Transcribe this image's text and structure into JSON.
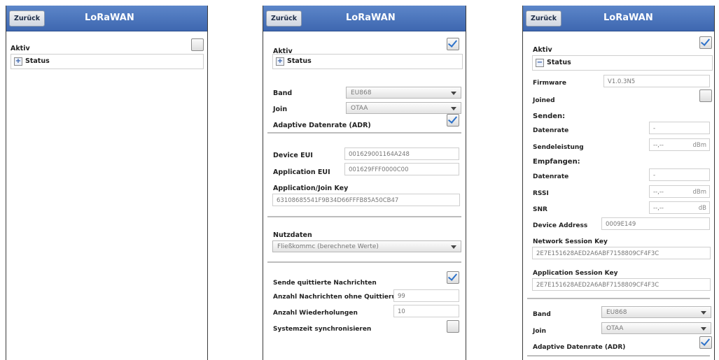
{
  "common": {
    "back_label": "Zurück",
    "title": "LoRaWAN",
    "aktiv": "Aktiv",
    "status": "Status",
    "plus": "+",
    "minus": "−"
  },
  "p2": {
    "band_label": "Band",
    "band_value": "EU868",
    "join_label": "Join",
    "join_value": "OTAA",
    "adr_label": "Adaptive Datenrate (ADR)",
    "device_eui_label": "Device EUI",
    "device_eui_value": "001629001164A248",
    "app_eui_label": "Application EUI",
    "app_eui_value": "001629FFF0000C00",
    "app_key_label": "Application/Join Key",
    "app_key_value": "63108685541F9B34D66FFFB85A50CB47",
    "nutzdaten_label": "Nutzdaten",
    "nutzdaten_value": "Fließkommc (berechnete Werte)",
    "sende_label": "Sende quittierte Nachrichten",
    "anzahl_ohne_label": "Anzahl Nachrichten ohne Quittierung",
    "anzahl_ohne_value": "99",
    "wiederholungen_label": "Anzahl Wiederholungen",
    "wiederholungen_value": "10",
    "systemzeit_label": "Systemzeit synchronisieren"
  },
  "p3": {
    "firmware_label": "Firmware",
    "firmware_value": "V1.0.3N5",
    "joined_label": "Joined",
    "senden_label": "Senden:",
    "datenrate_label": "Datenrate",
    "datenrate_send_value": "-",
    "sendeleistung_label": "Sendeleistung",
    "sendeleistung_value": "--,--",
    "sendeleistung_unit": "dBm",
    "empfangen_label": "Empfangen:",
    "datenrate_recv_value": "-",
    "rssi_label": "RSSI",
    "rssi_value": "--,--",
    "rssi_unit": "dBm",
    "snr_label": "SNR",
    "snr_value": "--,--",
    "snr_unit": "dB",
    "device_address_label": "Device Address",
    "device_address_value": "0009E149",
    "nwk_key_label": "Network Session Key",
    "nwk_key_value": "2E7E151628AED2A6ABF7158809CF4F3C",
    "app_session_label": "Application Session Key",
    "app_session_value": "2E7E151628AED2A6ABF7158809CF4F3C",
    "band_label": "Band",
    "band_value": "EU868",
    "join_label": "Join",
    "join_value": "OTAA",
    "adr_label": "Adaptive Datenrate (ADR)"
  }
}
